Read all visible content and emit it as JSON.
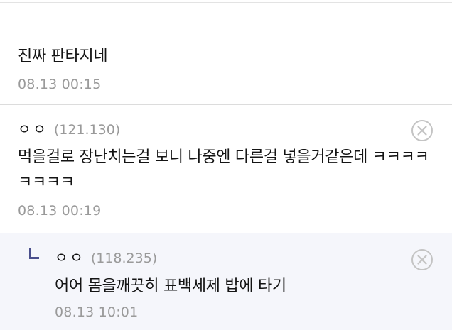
{
  "comments": [
    {
      "text": "진짜 판타지네",
      "date": "08.13 00:15"
    },
    {
      "nickname": "ㅇㅇ",
      "ip": "(121.130)",
      "text": "먹을걸로 장난치는걸 보니 나중엔 다른걸 넣을거같은데 ㅋㅋㅋㅋㅋㅋㅋㅋ",
      "date": "08.13 00:19",
      "delete_icon": "close-circle-icon"
    },
    {
      "is_reply": true,
      "nickname": "ㅇㅇ",
      "ip": "(118.235)",
      "text": "어어 몸을깨끗히 표백세제 밥에 타기",
      "date": "08.13 10:01",
      "delete_icon": "close-circle-icon"
    }
  ],
  "colors": {
    "reply_background": "#f5f6fb",
    "reply_marker": "#4a4f8c",
    "meta_text": "#9a9a9a",
    "divider": "#dcdcdc"
  }
}
